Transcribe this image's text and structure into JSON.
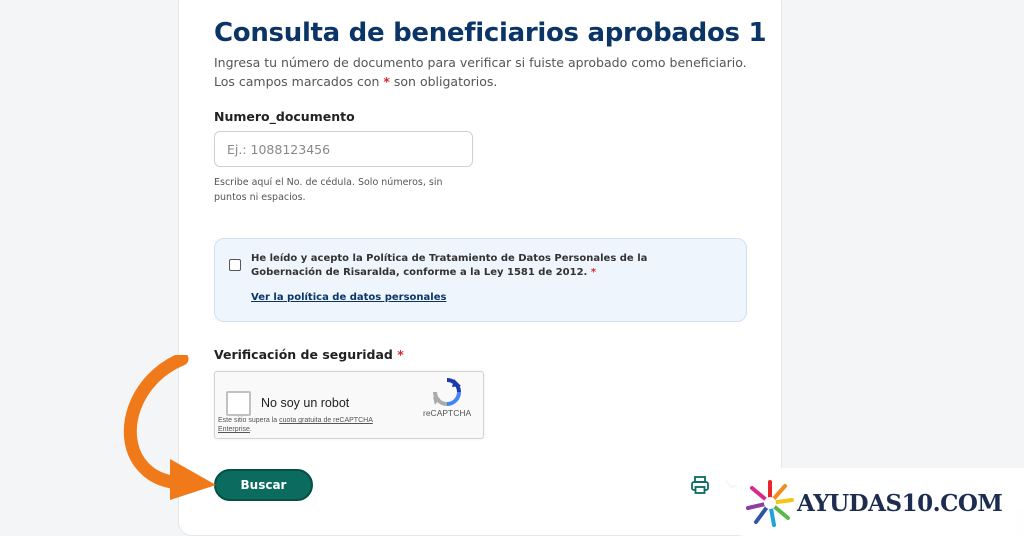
{
  "form": {
    "title": "Consulta de beneficiarios aprobados 1",
    "subtitle_line1": "Ingresa tu número de documento para verificar si fuiste aprobado como beneficiario.",
    "subtitle_line2_pre": "Los campos marcados con ",
    "required_mark": "*",
    "subtitle_line2_post": " son obligatorios.",
    "document_label": "Numero_documento",
    "document_placeholder": "Ej.: 1088123456",
    "document_value": "",
    "document_help": "Escribe aquí el No. de cédula. Solo números, sin puntos ni espacios.",
    "policy_text": "He leído y acepto la Política de Tratamiento de Datos Personales de la Gobernación de Risaralda, conforme a la Ley 1581 de 2012.",
    "policy_checked": false,
    "policy_link": "Ver la política de datos personales",
    "security_label": "Verificación de seguridad",
    "submit_label": "Buscar"
  },
  "captcha": {
    "label": "No soy un robot",
    "brand": "reCAPTCHA",
    "note_pre": "Este sitio supera la ",
    "note_link": "cuota gratuita de reCAPTCHA Enterprise",
    "note_post": "."
  },
  "watermark": {
    "text": "AYUDAS10.COM"
  },
  "icons": {
    "print": "printer-icon",
    "share": "share-icon",
    "arrow": "arrow-annotation-icon"
  },
  "colors": {
    "title": "#0b3566",
    "required": "#d7282f",
    "button": "#0b6b5e",
    "arrow": "#f07a1a",
    "policy_bg": "#eef5fd"
  }
}
